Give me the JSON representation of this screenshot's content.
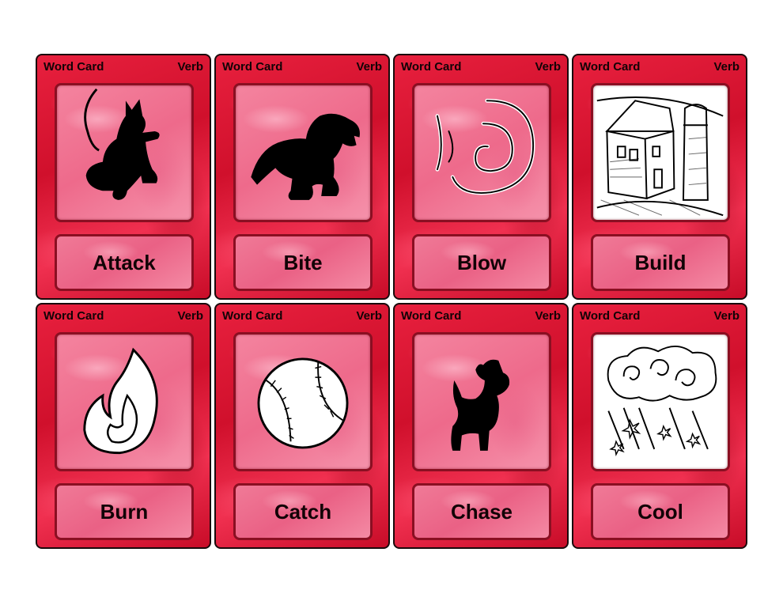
{
  "card_header": {
    "left": "Word Card",
    "right": "Verb"
  },
  "cards": [
    {
      "word": "Attack",
      "icon": "mouse-attack-icon"
    },
    {
      "word": "Bite",
      "icon": "dinosaur-icon"
    },
    {
      "word": "Blow",
      "icon": "wind-swirl-icon"
    },
    {
      "word": "Build",
      "icon": "house-silo-icon"
    },
    {
      "word": "Burn",
      "icon": "flame-icon"
    },
    {
      "word": "Catch",
      "icon": "baseball-icon"
    },
    {
      "word": "Chase",
      "icon": "dog-icon"
    },
    {
      "word": "Cool",
      "icon": "wind-snow-icon"
    }
  ],
  "colors": {
    "card": "#e01a38",
    "picture_box": "#f07a97",
    "border": "#8a0f22"
  }
}
